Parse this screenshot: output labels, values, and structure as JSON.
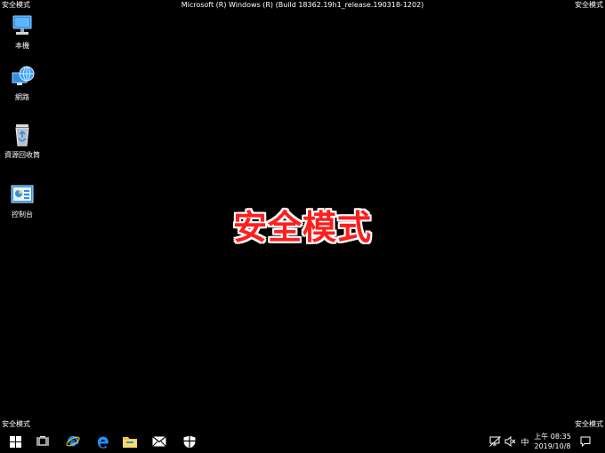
{
  "watermark": {
    "label": "安全模式",
    "build": "Microsoft (R) Windows (R) (Build 18362.19h1_release.190318-1202)"
  },
  "desktop": {
    "icons": [
      {
        "label": "本機",
        "icon": "computer-icon"
      },
      {
        "label": "網路",
        "icon": "network-icon"
      },
      {
        "label": "資源回收筒",
        "icon": "recycle-bin-icon"
      },
      {
        "label": "控制台",
        "icon": "control-panel-icon"
      }
    ],
    "center_text": "安全模式"
  },
  "taskbar": {
    "pinned": [
      {
        "name": "start",
        "icon": "windows-start-icon"
      },
      {
        "name": "task-view",
        "icon": "task-view-icon"
      },
      {
        "name": "internet-explorer",
        "icon": "internet-explorer-icon"
      },
      {
        "name": "edge",
        "icon": "edge-icon"
      },
      {
        "name": "file-explorer",
        "icon": "folder-icon"
      },
      {
        "name": "mail",
        "icon": "mail-icon"
      },
      {
        "name": "security",
        "icon": "shield-icon"
      }
    ],
    "tray": {
      "ime": "中",
      "clock_time": "上午 08:35",
      "clock_date": "2019/10/8"
    }
  },
  "colors": {
    "background": "#000000",
    "safe_mode_text": "#ff1e1e",
    "icon_blue": "#1e90ff"
  }
}
